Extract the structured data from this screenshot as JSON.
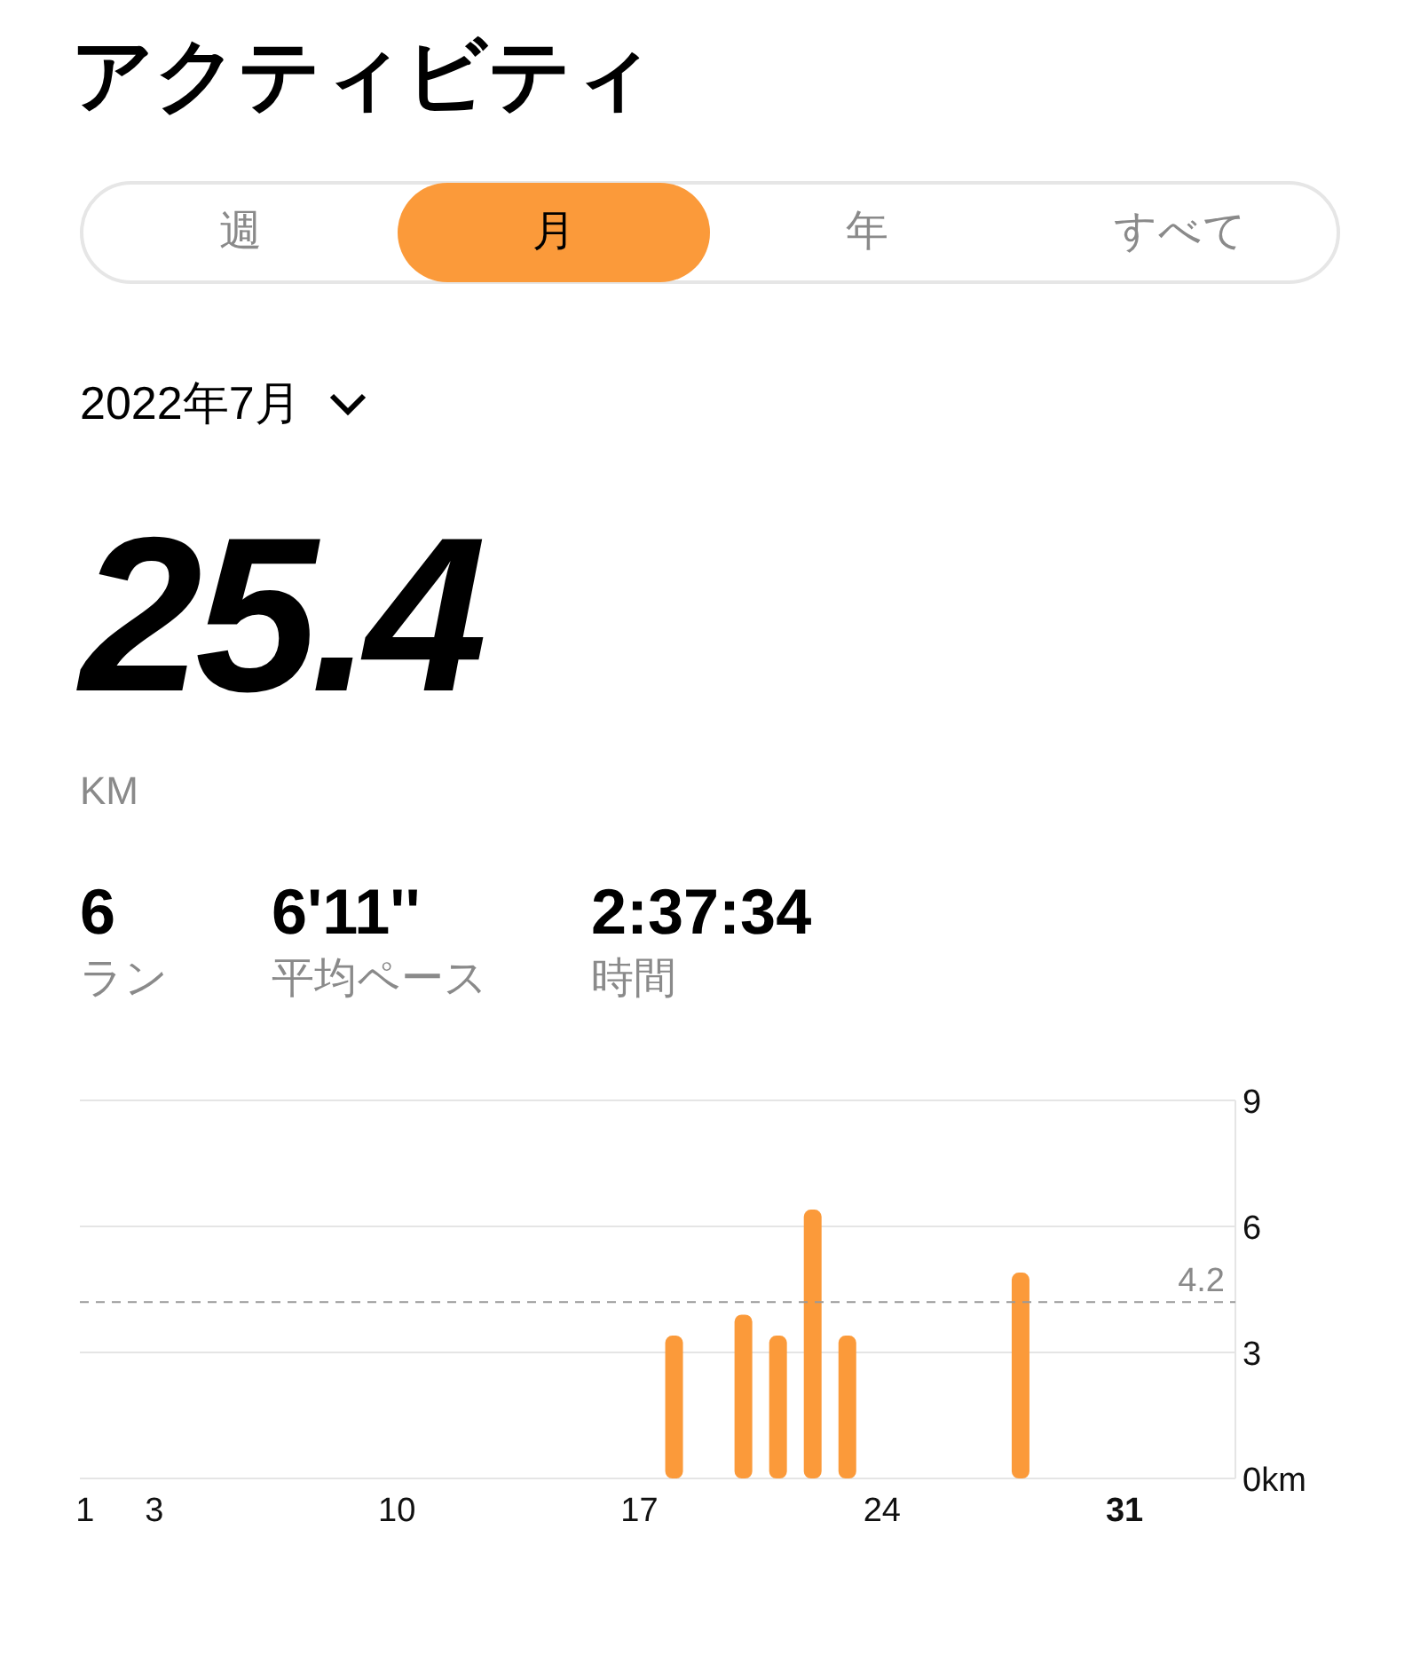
{
  "title": "アクティビティ",
  "tabs": [
    {
      "label": "週",
      "selected": false
    },
    {
      "label": "月",
      "selected": true
    },
    {
      "label": "年",
      "selected": false
    },
    {
      "label": "すべて",
      "selected": false
    }
  ],
  "period": {
    "label": "2022年7月"
  },
  "total": {
    "value": "25.4",
    "unit": "KM"
  },
  "stats": [
    {
      "value": "6",
      "label": "ラン"
    },
    {
      "value": "6'11''",
      "label": "平均ペース"
    },
    {
      "value": "2:37:34",
      "label": "時間"
    }
  ],
  "chart": {
    "chart_data": {
      "type": "bar",
      "x": [
        18,
        20,
        21,
        22,
        23,
        28
      ],
      "series": [
        {
          "color": "#fb9a3a",
          "values": [
            3.4,
            3.9,
            3.4,
            6.4,
            3.4,
            4.9
          ]
        }
      ],
      "xlim": [
        0.85,
        34.2
      ],
      "ylim": [
        0,
        9
      ],
      "xticks": [
        1,
        3,
        10,
        17,
        24,
        31
      ],
      "yticks": [
        {
          "value": 0,
          "label": "0km"
        },
        3,
        6,
        9
      ],
      "ref_lines": [
        {
          "axis": "y",
          "value": 4.2,
          "label": "4.2"
        }
      ]
    },
    "bold_xtick": "31"
  }
}
